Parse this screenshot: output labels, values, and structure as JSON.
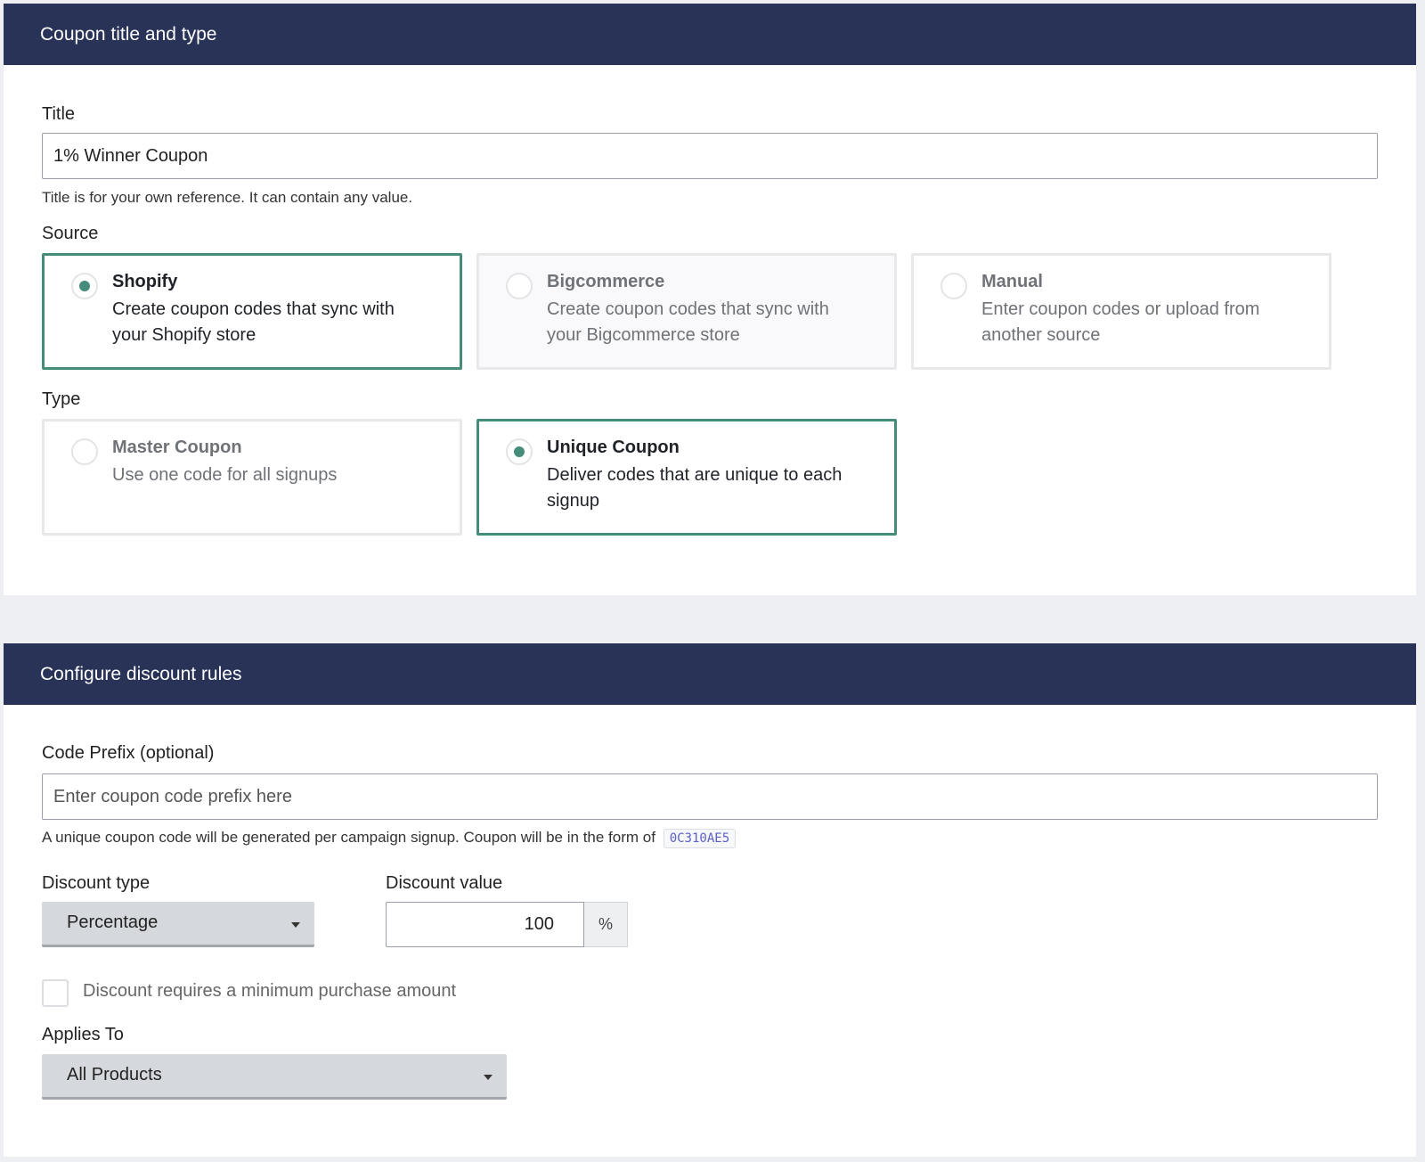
{
  "section1": {
    "header": "Coupon title and type",
    "title_label": "Title",
    "title_value": "1% Winner Coupon",
    "title_help": "Title is for your own reference. It can contain any value.",
    "source_label": "Source",
    "sources": [
      {
        "title": "Shopify",
        "desc": "Create coupon codes that sync with your Shopify store",
        "selected": true
      },
      {
        "title": "Bigcommerce",
        "desc": "Create coupon codes that sync with your Bigcommerce store",
        "selected": false
      },
      {
        "title": "Manual",
        "desc": "Enter coupon codes or upload from another source",
        "selected": false
      }
    ],
    "type_label": "Type",
    "types": [
      {
        "title": "Master Coupon",
        "desc": "Use one code for all signups",
        "selected": false
      },
      {
        "title": "Unique Coupon",
        "desc": "Deliver codes that are unique to each signup",
        "selected": true
      }
    ]
  },
  "section2": {
    "header": "Configure discount rules",
    "prefix_label": "Code Prefix (optional)",
    "prefix_placeholder": "Enter coupon code prefix here",
    "prefix_value": "",
    "prefix_help": "A unique coupon code will be generated per campaign signup. Coupon will be in the form of",
    "code_example": "0C310AE5",
    "discount_type_label": "Discount type",
    "discount_type_value": "Percentage",
    "discount_value_label": "Discount value",
    "discount_value": "100",
    "discount_suffix": "%",
    "min_purchase_label": "Discount requires a minimum purchase amount",
    "min_purchase_checked": false,
    "applies_to_label": "Applies To",
    "applies_to_value": "All Products"
  },
  "colors": {
    "header_bg": "#293358",
    "accent": "#468c7b",
    "page_bg": "#eeeff3"
  }
}
